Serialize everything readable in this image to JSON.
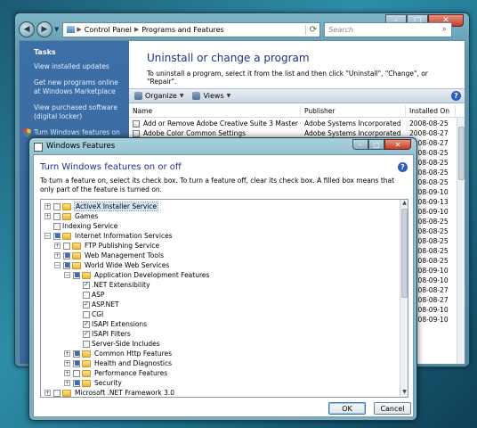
{
  "control_panel": {
    "breadcrumb": [
      "Control Panel",
      "Programs and Features"
    ],
    "search_placeholder": "Search",
    "sidebar": {
      "title": "Tasks",
      "tasks": [
        "View installed updates",
        "Get new programs online at Windows Marketplace",
        "View purchased software (digital locker)",
        "Turn Windows features on or off"
      ]
    },
    "heading": "Uninstall or change a program",
    "description": "To uninstall a program, select it from the list and then click \"Uninstall\", \"Change\", or \"Repair\".",
    "toolbar": {
      "organize": "Organize",
      "views": "Views",
      "help": "?"
    },
    "columns": [
      "Name",
      "Publisher",
      "Installed On"
    ],
    "rows": [
      {
        "name": "Add or Remove Adobe Creative Suite 3 Master Col...",
        "publisher": "Adobe Systems Incorporated",
        "date": "2008-08-25"
      },
      {
        "name": "Adobe Color Common Settings",
        "publisher": "Adobe Systems Incorporated",
        "date": "2008-08-27"
      },
      {
        "name": "",
        "publisher": "",
        "date": "2008-08-27"
      },
      {
        "name": "",
        "publisher": "",
        "date": "2008-08-25"
      },
      {
        "name": "",
        "publisher": "",
        "date": "2008-08-25"
      },
      {
        "name": "",
        "publisher": "",
        "date": "2008-08-25"
      },
      {
        "name": "",
        "publisher": "",
        "date": "2008-08-25"
      },
      {
        "name": "",
        "publisher": "",
        "date": "2008-09-10"
      },
      {
        "name": "",
        "publisher": "",
        "date": "2008-09-13"
      },
      {
        "name": "",
        "publisher": "",
        "date": "2008-09-10"
      },
      {
        "name": "",
        "publisher": "",
        "date": "2008-08-25"
      },
      {
        "name": "",
        "publisher": "",
        "date": "2008-08-25"
      },
      {
        "name": "",
        "publisher": "",
        "date": "2008-08-25"
      },
      {
        "name": "",
        "publisher": "",
        "date": "2008-08-25"
      },
      {
        "name": "",
        "publisher": "",
        "date": "2008-08-25"
      },
      {
        "name": "",
        "publisher": "",
        "date": "2008-09-10"
      },
      {
        "name": "",
        "publisher": "",
        "date": "2008-09-10"
      },
      {
        "name": "",
        "publisher": "",
        "date": "2008-08-27"
      },
      {
        "name": "",
        "publisher": "",
        "date": "2008-08-27"
      },
      {
        "name": "",
        "publisher": "",
        "date": "2008-09-10"
      },
      {
        "name": "",
        "publisher": "",
        "date": "2008-09-10"
      }
    ]
  },
  "features_dialog": {
    "title": "Windows Features",
    "heading": "Turn Windows features on or off",
    "help": "?",
    "description": "To turn a feature on, select its check box. To turn a feature off, clear its check box. A filled box means that only part of the feature is turned on.",
    "items": [
      {
        "label": "ActiveX Installer Service",
        "level": 0,
        "expander": "plus",
        "state": "unchecked",
        "folder": true,
        "selected": true
      },
      {
        "label": "Games",
        "level": 0,
        "expander": "plus",
        "state": "unchecked",
        "folder": true
      },
      {
        "label": "Indexing Service",
        "level": 0,
        "expander": "none",
        "state": "unchecked",
        "folder": false
      },
      {
        "label": "Internet Information Services",
        "level": 0,
        "expander": "minus",
        "state": "partial",
        "folder": true
      },
      {
        "label": "FTP Publishing Service",
        "level": 1,
        "expander": "plus",
        "state": "unchecked",
        "folder": true
      },
      {
        "label": "Web Management Tools",
        "level": 1,
        "expander": "plus",
        "state": "partial",
        "folder": true
      },
      {
        "label": "World Wide Web Services",
        "level": 1,
        "expander": "minus",
        "state": "partial",
        "folder": true
      },
      {
        "label": "Application Development Features",
        "level": 2,
        "expander": "minus",
        "state": "partial",
        "folder": true
      },
      {
        "label": ".NET Extensibility",
        "level": 3,
        "expander": "none",
        "state": "checked",
        "folder": false
      },
      {
        "label": "ASP",
        "level": 3,
        "expander": "none",
        "state": "unchecked",
        "folder": false
      },
      {
        "label": "ASP.NET",
        "level": 3,
        "expander": "none",
        "state": "checked",
        "folder": false
      },
      {
        "label": "CGI",
        "level": 3,
        "expander": "none",
        "state": "unchecked",
        "folder": false
      },
      {
        "label": "ISAPI Extensions",
        "level": 3,
        "expander": "none",
        "state": "checked",
        "folder": false
      },
      {
        "label": "ISAPI Filters",
        "level": 3,
        "expander": "none",
        "state": "checked",
        "folder": false
      },
      {
        "label": "Server-Side Includes",
        "level": 3,
        "expander": "none",
        "state": "unchecked",
        "folder": false
      },
      {
        "label": "Common Http Features",
        "level": 2,
        "expander": "plus",
        "state": "partial",
        "folder": true
      },
      {
        "label": "Health and Diagnostics",
        "level": 2,
        "expander": "plus",
        "state": "partial",
        "folder": true
      },
      {
        "label": "Performance Features",
        "level": 2,
        "expander": "plus",
        "state": "unchecked",
        "folder": true
      },
      {
        "label": "Security",
        "level": 2,
        "expander": "plus",
        "state": "partial",
        "folder": true
      },
      {
        "label": "Microsoft .NET Framework 3.0",
        "level": 0,
        "expander": "plus",
        "state": "unchecked",
        "folder": true
      }
    ],
    "ok_label": "OK",
    "cancel_label": "Cancel"
  }
}
